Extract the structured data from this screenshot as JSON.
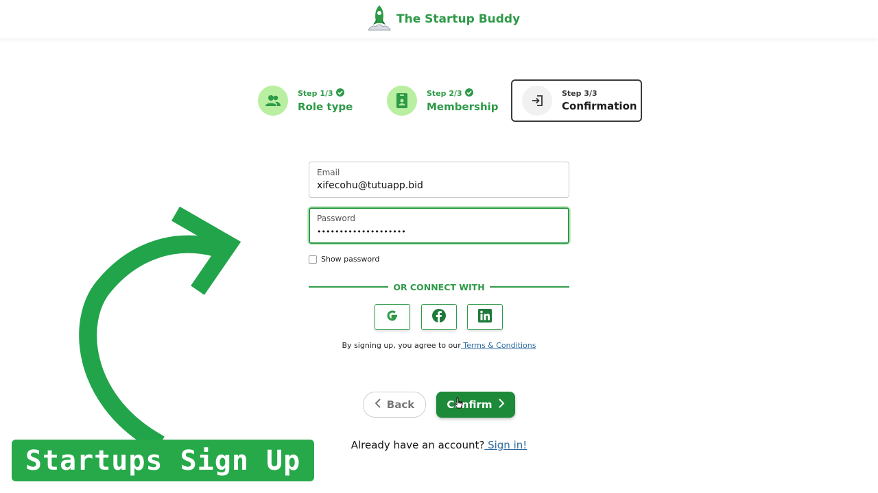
{
  "header": {
    "brand_name": "The Startup Buddy"
  },
  "steps": [
    {
      "num": "Step 1/3",
      "title": "Role type",
      "status": "completed",
      "icon": "users-icon"
    },
    {
      "num": "Step 2/3",
      "title": "Membership",
      "status": "completed",
      "icon": "id-card-icon"
    },
    {
      "num": "Step 3/3",
      "title": "Confirmation",
      "status": "current",
      "icon": "sign-in-icon"
    }
  ],
  "form": {
    "email_label": "Email",
    "email_value": "xifecohu@tutuapp.bid",
    "password_label": "Password",
    "password_value": "••••••••••••••••••••",
    "show_password_label": "Show password",
    "connect_label": "OR CONNECT WITH",
    "social": [
      "google-icon",
      "facebook-icon",
      "linkedin-icon"
    ],
    "terms_prefix": "By signing up, you agree to our",
    "terms_link": " Terms & Conditions",
    "back_label": "Back",
    "confirm_label": "Confirm",
    "account_prefix": "Already have an account?",
    "signin_link": " Sign in!"
  },
  "overlay": {
    "banner_text": "Startups Sign Up"
  },
  "colors": {
    "brand_green": "#2e9a48",
    "confirm_green": "#1d8a3a",
    "banner_green": "#27a94a",
    "link_blue": "#2d6a9f"
  }
}
